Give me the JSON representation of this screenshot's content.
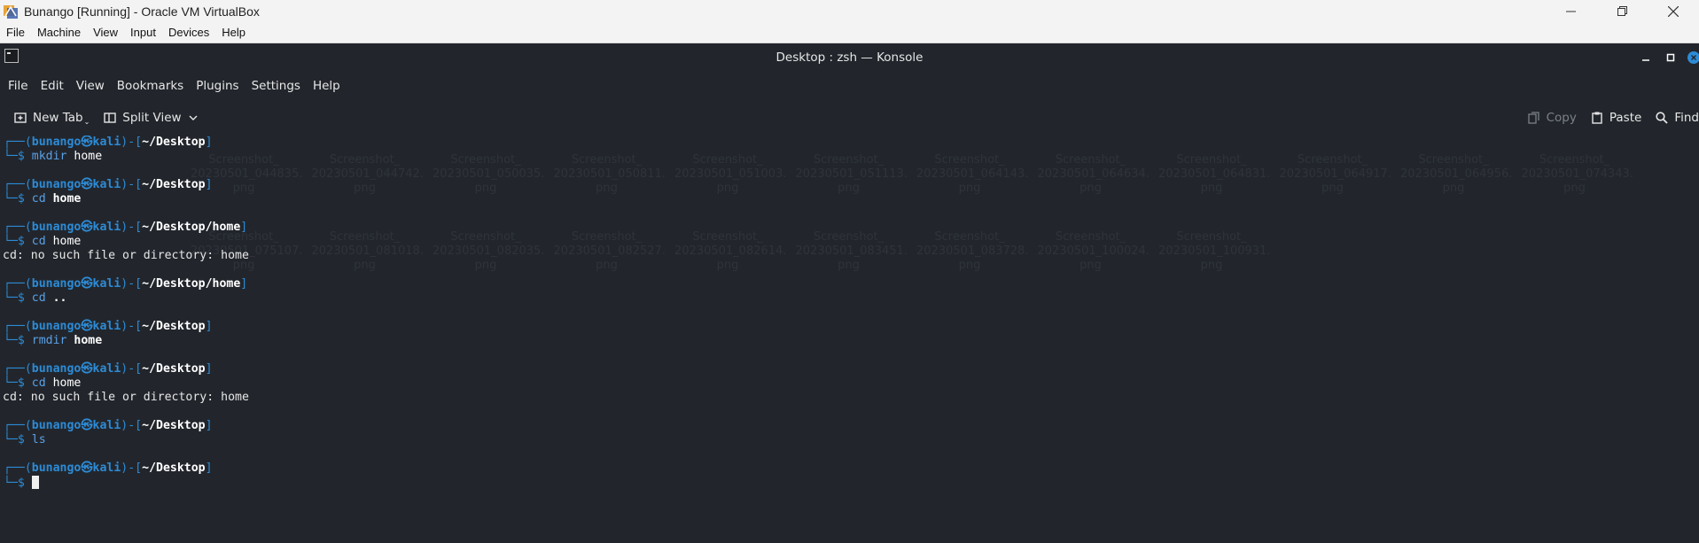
{
  "host": {
    "title": "Bunango [Running] - Oracle VM VirtualBox",
    "menu": [
      "File",
      "Machine",
      "View",
      "Input",
      "Devices",
      "Help"
    ]
  },
  "konsole": {
    "title": "Desktop : zsh — Konsole",
    "menu": [
      "File",
      "Edit",
      "View",
      "Bookmarks",
      "Plugins",
      "Settings",
      "Help"
    ],
    "toolbar": {
      "new_tab": "New Tab",
      "split_view": "Split View",
      "copy": "Copy",
      "paste": "Paste",
      "find": "Find"
    }
  },
  "terminal": {
    "user": "bunango",
    "at": "㉿",
    "host": "kali",
    "entries": [
      {
        "path": "~/Desktop",
        "cmd": "mkdir",
        "arg": "home",
        "arg_bold": false,
        "output": ""
      },
      {
        "path": "~/Desktop",
        "cmd": "cd",
        "arg": "home",
        "arg_bold": true,
        "output": ""
      },
      {
        "path": "~/Desktop/home",
        "cmd": "cd",
        "arg": "home",
        "arg_bold": false,
        "output": "cd: no such file or directory: home"
      },
      {
        "path": "~/Desktop/home",
        "cmd": "cd",
        "arg": "..",
        "arg_bold": true,
        "output": ""
      },
      {
        "path": "~/Desktop",
        "cmd": "rmdir",
        "arg": "home",
        "arg_bold": true,
        "output": ""
      },
      {
        "path": "~/Desktop",
        "cmd": "cd",
        "arg": "home",
        "arg_bold": false,
        "output": "cd: no such file or directory: home"
      },
      {
        "path": "~/Desktop",
        "cmd": "ls",
        "arg": "",
        "arg_bold": false,
        "output": ""
      },
      {
        "path": "~/Desktop",
        "cmd": "",
        "arg": "",
        "arg_bold": false,
        "output": "",
        "cursor": true
      }
    ]
  },
  "background_files": {
    "row1": [
      "Screenshot_20230501_044835.png",
      "Screenshot_20230501_044742.png",
      "Screenshot_20230501_050035.png",
      "Screenshot_20230501_050811.png",
      "Screenshot_20230501_051003.png",
      "Screenshot_20230501_051113.png",
      "Screenshot_20230501_064143.png",
      "Screenshot_20230501_064634.png",
      "Screenshot_20230501_064831.png",
      "Screenshot_20230501_064917.png",
      "Screenshot_20230501_064956.png",
      "Screenshot_20230501_074343.png"
    ],
    "row2": [
      "Screenshot_20230501_075107.png",
      "Screenshot_20230501_081018.png",
      "Screenshot_20230501_082035.png",
      "Screenshot_20230501_082527.png",
      "Screenshot_20230501_082614.png",
      "Screenshot_20230501_083451.png",
      "Screenshot_20230501_083728.png",
      "Screenshot_20230501_100024.png",
      "Screenshot_20230501_100931.png"
    ]
  },
  "colors": {
    "terminal_bg": "#22262c",
    "prompt_blue": "#2d8bd6",
    "command_blue": "#5aa0e6"
  }
}
